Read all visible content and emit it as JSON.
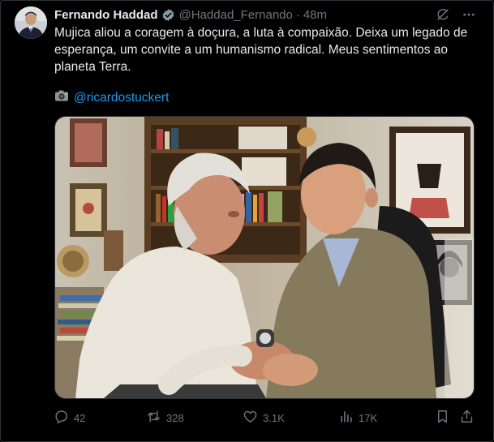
{
  "tweet": {
    "author_name": "Fernando Haddad",
    "handle": "@Haddad_Fernando",
    "separator": "·",
    "time": "48m",
    "text_lines": [
      "Mujica aliou a coragem à doçura, a luta à compaixão. Deixa um legado de",
      "esperança, um convite a um humanismo radical. Meus sentimentos ao",
      "planeta Terra."
    ],
    "photo_credit_icon": "camera-emoji",
    "photo_credit": "@ricardostuckert"
  },
  "stats": {
    "replies": "42",
    "reposts": "328",
    "likes": "3.1K",
    "views": "17K"
  },
  "icons": {
    "verified": "verified-badge-icon",
    "grok": "grok-icon",
    "more": "more-icon",
    "reply": "reply-icon",
    "repost": "repost-icon",
    "like": "heart-icon",
    "views": "views-icon",
    "bookmark": "bookmark-icon",
    "share": "share-icon"
  },
  "colors": {
    "background": "#000000",
    "text": "#e7e9ea",
    "muted": "#71767b",
    "link": "#1d9bf0",
    "verified": "#829aab"
  }
}
